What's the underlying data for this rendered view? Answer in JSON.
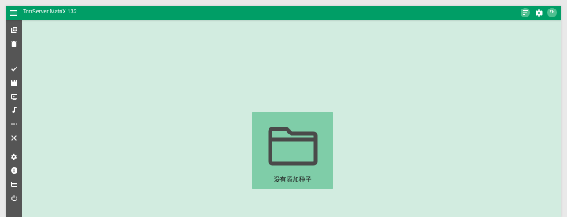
{
  "app": {
    "title": "TorrServer MatriX.132"
  },
  "header": {
    "menu_icon": "hamburger-menu-icon",
    "sort_icon": "sort-lines-icon",
    "settings_icon": "gear-icon",
    "language_label": "ZH"
  },
  "sidebar": {
    "items": [
      {
        "name": "add-torrent",
        "icon": "library-add-icon"
      },
      {
        "name": "remove-all",
        "icon": "trash-icon"
      },
      {
        "name": "filter-done",
        "icon": "check-icon"
      },
      {
        "name": "filter-movies",
        "icon": "clapperboard-icon"
      },
      {
        "name": "filter-tv",
        "icon": "tv-icon"
      },
      {
        "name": "filter-music",
        "icon": "music-note-icon"
      },
      {
        "name": "filter-other",
        "icon": "more-horizontal-icon"
      },
      {
        "name": "close",
        "icon": "close-icon"
      },
      {
        "name": "settings",
        "icon": "gear-icon"
      },
      {
        "name": "about",
        "icon": "info-icon"
      },
      {
        "name": "donate",
        "icon": "credit-card-icon"
      },
      {
        "name": "shutdown",
        "icon": "power-icon"
      }
    ]
  },
  "main": {
    "empty_icon": "folder-icon",
    "empty_message": "没有添加种子"
  },
  "colors": {
    "appbar": "#009e66",
    "sidebar": "#555555",
    "background": "#d2ece0",
    "card": "#7fcda8",
    "header_button": "#4fbf90",
    "icon_dark": "#4a4a4a"
  }
}
